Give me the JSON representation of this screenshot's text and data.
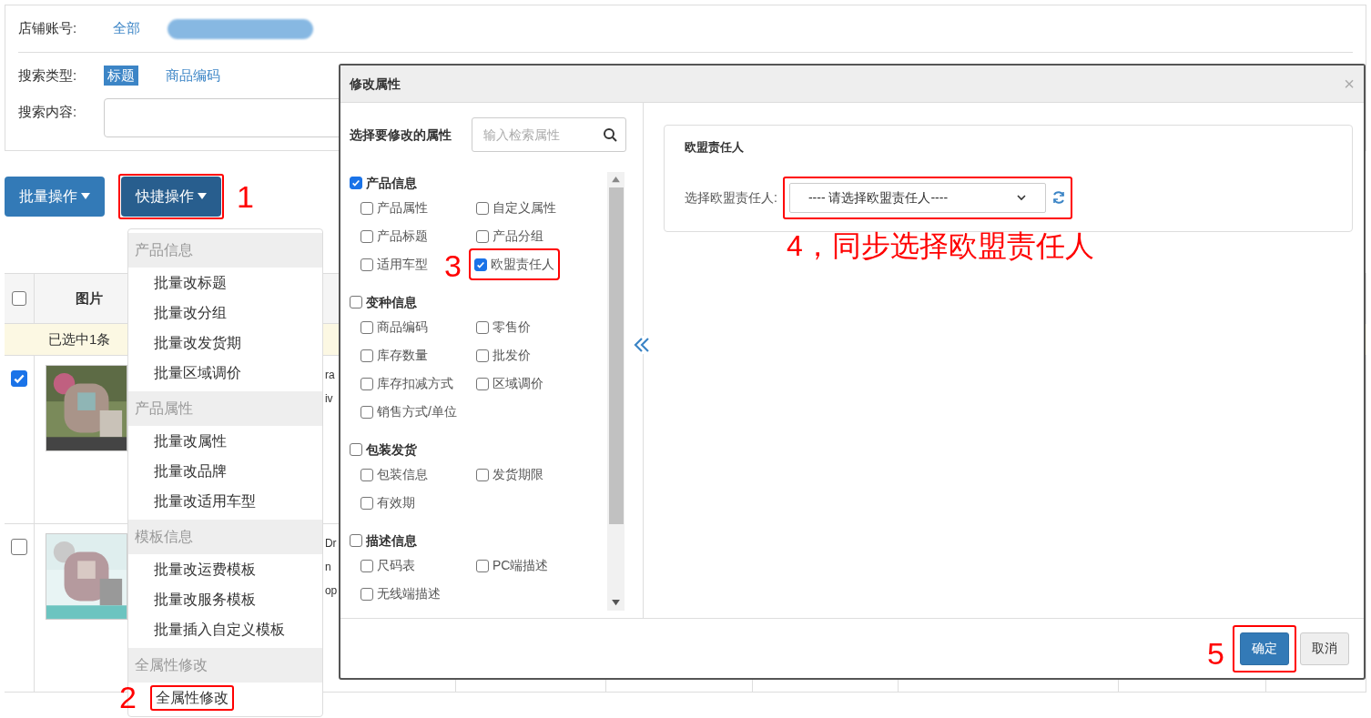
{
  "filter": {
    "shop_label": "店铺账号:",
    "shop_options": [
      {
        "label": "全部",
        "selected": false
      }
    ],
    "search_type_label": "搜索类型:",
    "search_types": [
      {
        "label": "标题",
        "selected": true
      },
      {
        "label": "商品编码",
        "selected": false
      }
    ],
    "search_content_label": "搜索内容:"
  },
  "toolbar": [
    {
      "label": "批量操作",
      "active": false
    },
    {
      "label": "快捷操作",
      "active": true,
      "annotation": "1"
    }
  ],
  "dropdown": {
    "sections": [
      {
        "header": "产品信息",
        "items": [
          {
            "label": "批量改标题"
          },
          {
            "label": "批量改分组"
          },
          {
            "label": "批量改发货期"
          },
          {
            "label": "批量区域调价"
          }
        ]
      },
      {
        "header": "产品属性",
        "items": [
          {
            "label": "批量改属性"
          },
          {
            "label": "批量改品牌"
          },
          {
            "label": "批量改适用车型"
          }
        ]
      },
      {
        "header": "模板信息",
        "items": [
          {
            "label": "批量改运费模板"
          },
          {
            "label": "批量改服务模板"
          },
          {
            "label": "批量插入自定义模板"
          }
        ]
      },
      {
        "header": "全属性修改",
        "items": [
          {
            "label": "全属性修改",
            "annotation": "2"
          }
        ]
      }
    ]
  },
  "table": {
    "header_checked": false,
    "columns": [
      "图片"
    ],
    "selection_notice": "已选中1条",
    "rows": [
      {
        "checked": true,
        "column_3": [
          "ra",
          "iv"
        ]
      },
      {
        "checked": false,
        "column_3": [
          "Dr",
          "n",
          "op"
        ]
      }
    ]
  },
  "modal": {
    "title": "修改属性",
    "close": "×",
    "left_title": "选择要修改的属性",
    "search_placeholder": "输入检索属性",
    "groups": [
      {
        "label": "产品信息",
        "checked": true,
        "children": [
          {
            "label": "产品属性",
            "checked": false
          },
          {
            "label": "自定义属性",
            "checked": false
          },
          {
            "label": "产品标题",
            "checked": false
          },
          {
            "label": "产品分组",
            "checked": false
          },
          {
            "label": "适用车型",
            "checked": false
          },
          {
            "label": "欧盟责任人",
            "checked": true,
            "annotation": "3"
          }
        ]
      },
      {
        "label": "变种信息",
        "checked": false,
        "children": [
          {
            "label": "商品编码",
            "checked": false
          },
          {
            "label": "零售价",
            "checked": false
          },
          {
            "label": "库存数量",
            "checked": false
          },
          {
            "label": "批发价",
            "checked": false
          },
          {
            "label": "库存扣减方式",
            "checked": false
          },
          {
            "label": "区域调价",
            "checked": false
          },
          {
            "label": "销售方式/单位",
            "checked": false
          }
        ]
      },
      {
        "label": "包装发货",
        "checked": false,
        "children": [
          {
            "label": "包装信息",
            "checked": false
          },
          {
            "label": "发货期限",
            "checked": false
          },
          {
            "label": "有效期",
            "checked": false
          }
        ]
      },
      {
        "label": "描述信息",
        "checked": false,
        "children": [
          {
            "label": "尺码表",
            "checked": false
          },
          {
            "label": "PC端描述",
            "checked": false
          },
          {
            "label": "无线端描述",
            "checked": false
          }
        ]
      }
    ],
    "card_title": "欧盟责任人",
    "select_label": "选择欧盟责任人:",
    "select_value": "---- 请选择欧盟责任人----",
    "select_annotation": "4，同步选择欧盟责任人",
    "buttons": [
      {
        "label": "确定",
        "kind": "primary",
        "annotation": "5"
      },
      {
        "label": "取消",
        "kind": "default"
      }
    ]
  }
}
